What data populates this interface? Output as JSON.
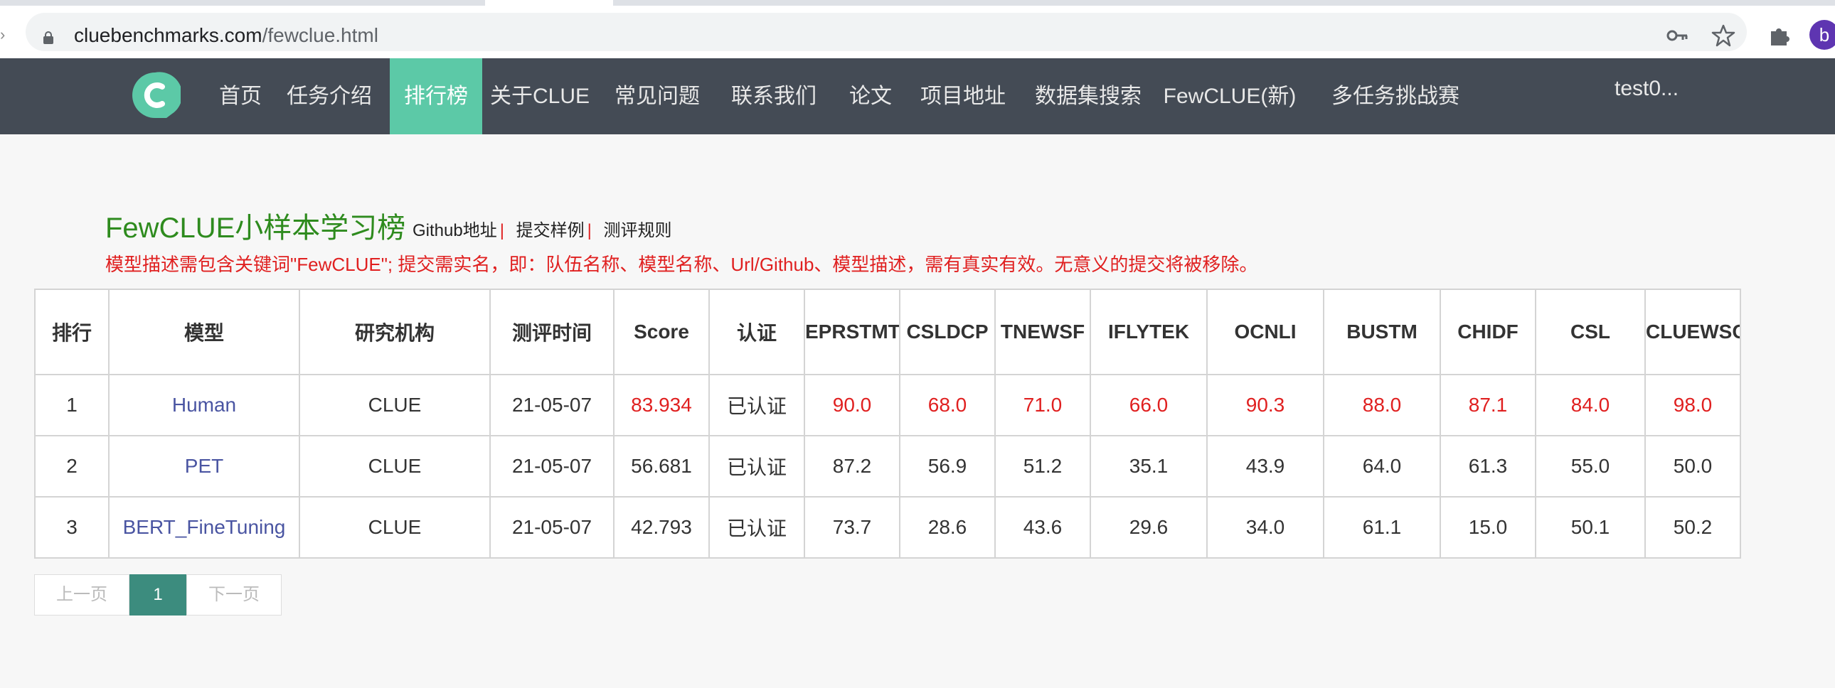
{
  "browser": {
    "url_domain": "cluebenchmarks.com",
    "url_path": "/fewclue.html",
    "profile_initial": "b"
  },
  "nav": {
    "items": [
      "首页",
      "任务介绍",
      "排行榜",
      "关于CLUE",
      "常见问题",
      "联系我们",
      "论文",
      "项目地址",
      "数据集搜索",
      "FewCLUE(新)",
      "多任务挑战赛"
    ],
    "active_index": 2,
    "user": "test0..."
  },
  "page": {
    "title": "FewCLUE小样本学习榜",
    "links": [
      "Github地址",
      "提交样例",
      "测评规则"
    ],
    "notice": "模型描述需包含关键词\"FewCLUE\"; 提交需实名，即：队伍名称、模型名称、Url/Github、模型描述，需有真实有效。无意义的提交将被移除。"
  },
  "table": {
    "headers": [
      "排行",
      "模型",
      "研究机构",
      "测评时间",
      "Score",
      "认证",
      "EPRSTMT",
      "CSLDCP",
      "TNEWSF",
      "IFLYTEK",
      "OCNLI",
      "BUSTM",
      "CHIDF",
      "CSL",
      "CLUEWSC"
    ],
    "rows": [
      {
        "cells": [
          "1",
          "Human",
          "CLUE",
          "21-05-07",
          "83.934",
          "已认证",
          "90.0",
          "68.0",
          "71.0",
          "66.0",
          "90.3",
          "88.0",
          "87.1",
          "84.0",
          "98.0"
        ],
        "highlight": true
      },
      {
        "cells": [
          "2",
          "PET",
          "CLUE",
          "21-05-07",
          "56.681",
          "已认证",
          "87.2",
          "56.9",
          "51.2",
          "35.1",
          "43.9",
          "64.0",
          "61.3",
          "55.0",
          "50.0"
        ],
        "highlight": false
      },
      {
        "cells": [
          "3",
          "BERT_FineTuning",
          "CLUE",
          "21-05-07",
          "42.793",
          "已认证",
          "73.7",
          "28.6",
          "43.6",
          "29.6",
          "34.0",
          "61.1",
          "15.0",
          "50.1",
          "50.2"
        ],
        "highlight": false
      }
    ]
  },
  "pagination": {
    "prev": "上一页",
    "current": "1",
    "next": "下一页"
  },
  "colors": {
    "navbar_bg": "#444b55",
    "nav_active": "#5cc9a7",
    "title_green": "#2e8b1e",
    "highlight_red": "#e02020",
    "model_link": "#4a55a2",
    "pager_active": "#3c8c7e"
  }
}
